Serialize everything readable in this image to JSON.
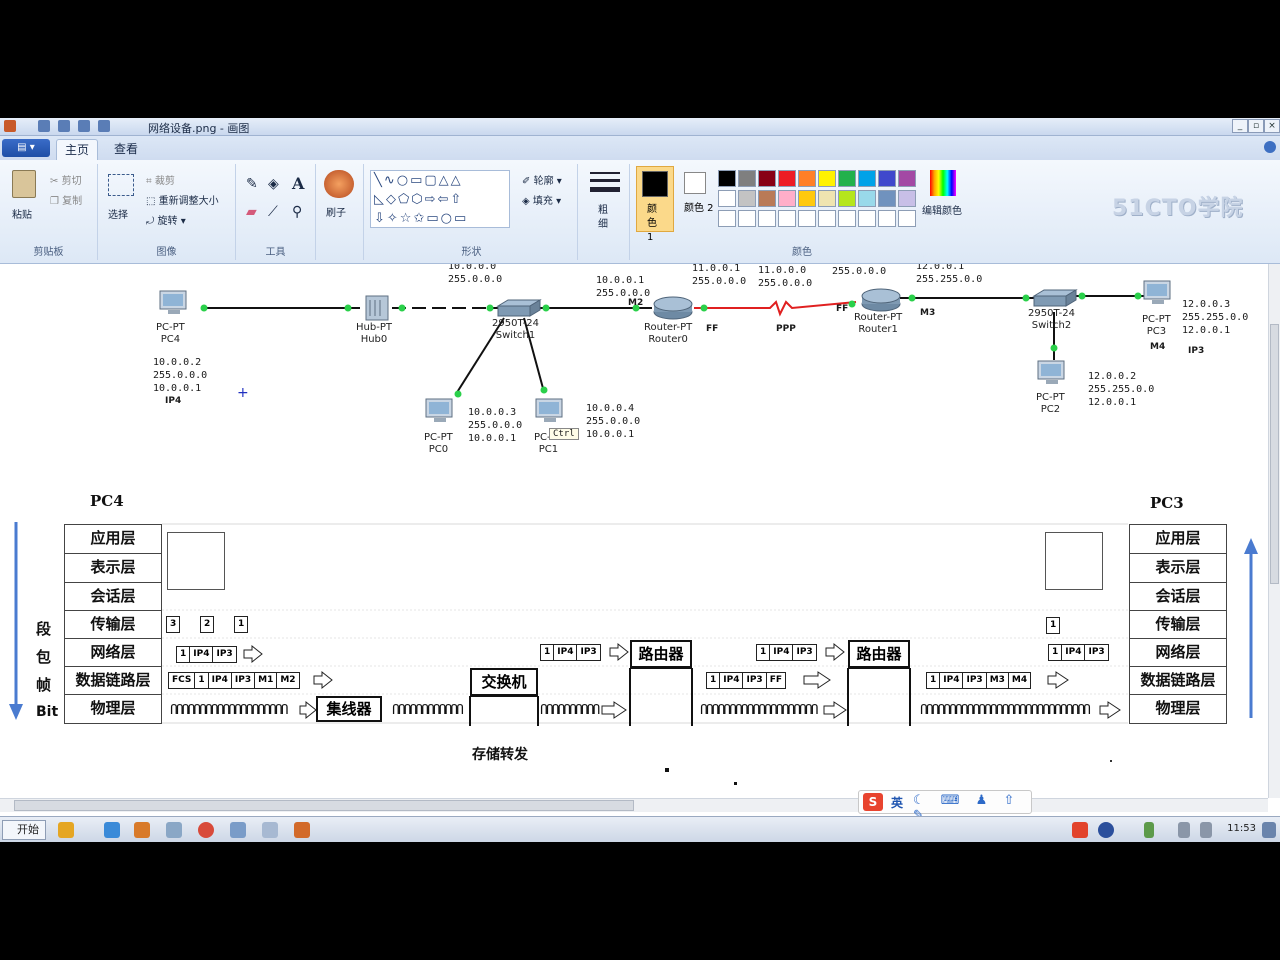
{
  "window": {
    "title": "网络设备.png - 画图",
    "controls": [
      "_",
      "▫",
      "×"
    ]
  },
  "ribbon": {
    "tabs": [
      "主页",
      "查看"
    ],
    "clipboard": {
      "paste": "粘贴",
      "cut": "剪切",
      "copy": "复制",
      "label": "剪贴板"
    },
    "image": {
      "select": "选择",
      "crop": "裁剪",
      "resize": "重新调整大小",
      "rotate": "旋转",
      "label": "图像"
    },
    "tools": {
      "label": "工具",
      "text_glyph": "A"
    },
    "brushes": {
      "label": "刷子"
    },
    "shapes": {
      "outline": "轮廓",
      "fill": "填充",
      "label": "形状"
    },
    "size": {
      "label": "粗细"
    },
    "colors": {
      "color1": "颜色 1",
      "color2": "颜色 2",
      "edit": "编辑颜色",
      "label": "颜色",
      "palette_row1": [
        "#000000",
        "#7f7f7f",
        "#880015",
        "#ed1c24",
        "#ff7f27",
        "#fff200",
        "#22b14c",
        "#00a2e8",
        "#3f48cc",
        "#a349a4"
      ],
      "palette_row2": [
        "#ffffff",
        "#c3c3c3",
        "#b97a57",
        "#ffaec9",
        "#ffc90e",
        "#efe4b0",
        "#b5e61d",
        "#99d9ea",
        "#7092be",
        "#c8bfe7"
      ]
    },
    "watermark": "51CTO学院"
  },
  "topology": {
    "devices": [
      {
        "type": "PC-PT",
        "name": "PC4"
      },
      {
        "type": "Hub-PT",
        "name": "Hub0"
      },
      {
        "type": "2950T-24",
        "name": "Switch1"
      },
      {
        "type": "Router-PT",
        "name": "Router0"
      },
      {
        "type": "Router-PT",
        "name": "Router1"
      },
      {
        "type": "2950T-24",
        "name": "Switch2"
      },
      {
        "type": "PC-PT",
        "name": "PC3"
      },
      {
        "type": "PC-PT",
        "name": "PC2"
      },
      {
        "type": "PC-PT",
        "name": "PC0"
      },
      {
        "type": "PC-PT",
        "name": "PC1"
      }
    ],
    "notes": {
      "pc4": [
        "10.0.0.2",
        "255.0.0.0",
        "10.0.0.1",
        "IP4"
      ],
      "switch1_top": [
        "10.0.0.0",
        "255.0.0.0"
      ],
      "router0_top": [
        "10.0.0.1",
        "255.0.0.0"
      ],
      "router0_port": "M2",
      "router0_ff": "FF",
      "link_ppp": "PPP",
      "link_top": [
        "11.0.0.1",
        "255.0.0.0"
      ],
      "link_top2": [
        "11.0.0.0",
        "255.0.0.0"
      ],
      "router1_top": "255.0.0.0",
      "router1_ff": "FF",
      "router1_port": "M3",
      "switch2_top": [
        "12.0.0.1",
        "255.255.0.0"
      ],
      "pc3": [
        "12.0.0.3",
        "255.255.0.0",
        "12.0.0.1"
      ],
      "pc3_m4": "M4",
      "pc3_ip": "IP3",
      "pc2": [
        "12.0.0.2",
        "255.255.0.0",
        "12.0.0.1"
      ],
      "pc0": [
        "10.0.0.3",
        "255.0.0.0",
        "10.0.0.1"
      ],
      "pc1": [
        "10.0.0.4",
        "255.0.0.0",
        "10.0.0.1"
      ],
      "tooltip": "Ctrl"
    }
  },
  "model": {
    "left_title": "PC4",
    "right_title": "PC3",
    "layers": [
      "应用层",
      "表示层",
      "会话层",
      "传输层",
      "网络层",
      "数据链路层",
      "物理层"
    ],
    "side_labels": [
      "段",
      "包",
      "帧",
      "Bit"
    ],
    "segments": [
      "3",
      "2",
      "1"
    ],
    "right_segment": "1",
    "packet_pc4": [
      "1",
      "IP4",
      "IP3"
    ],
    "frame_pc4": [
      "FCS",
      "1",
      "IP4",
      "IP3",
      "M1",
      "M2"
    ],
    "packet_mid1": [
      "1",
      "IP4",
      "IP3"
    ],
    "packet_mid2": [
      "1",
      "IP4",
      "IP3"
    ],
    "frame_mid2": [
      "1",
      "IP4",
      "IP3",
      "FF"
    ],
    "packet_pc3": [
      "1",
      "IP4",
      "IP3"
    ],
    "frame_pc3": [
      "1",
      "IP4",
      "IP3",
      "M3",
      "M4"
    ],
    "hub": "集线器",
    "switch": "交换机",
    "router1": "路由器",
    "router2": "路由器",
    "store_forward": "存储转发"
  },
  "ime": {
    "lang": "英"
  },
  "taskbar": {
    "start": "开始",
    "clock": "11:53"
  }
}
